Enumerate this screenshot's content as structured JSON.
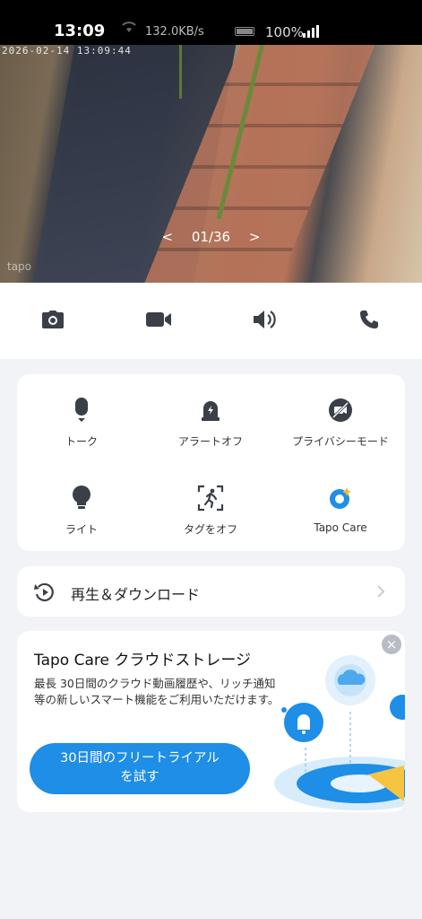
{
  "status_bar": {
    "time": "13:09",
    "network_speed": "132.0KB/s",
    "battery": "100%"
  },
  "camera": {
    "timestamp": "2026-02-14 13:09:44",
    "pager": {
      "prev": "<",
      "position": "01/36",
      "next": ">"
    },
    "watermark": "tapo"
  },
  "controls": {
    "items": [
      {
        "name": "snapshot",
        "icon": "camera-icon"
      },
      {
        "name": "record",
        "icon": "video-camera-icon"
      },
      {
        "name": "speaker",
        "icon": "speaker-icon"
      },
      {
        "name": "call",
        "icon": "phone-icon"
      }
    ]
  },
  "features": {
    "items": [
      {
        "label": "トーク",
        "icon": "microphone-icon"
      },
      {
        "label": "アラートオフ",
        "icon": "alarm-bell-icon"
      },
      {
        "label": "プライバシーモード",
        "icon": "privacy-camera-off-icon"
      },
      {
        "label": "ライト",
        "icon": "lightbulb-icon"
      },
      {
        "label": "タグをオフ",
        "icon": "person-tracking-icon"
      },
      {
        "label": "Tapo Care",
        "icon": "tapo-care-icon"
      }
    ]
  },
  "playback": {
    "label": "再生＆ダウンロード",
    "icon": "playback-icon"
  },
  "promo": {
    "title": "Tapo Care クラウドストレージ",
    "description": "最長 30日間のクラウド動画履歴や、リッチ通知等の新しいスマート機能をご利用いただけます。",
    "button_line1": "30日間のフリートライアル",
    "button_line2": "を試す"
  },
  "colors": {
    "accent": "#1e8ee6",
    "background": "#f2f3f7",
    "icon": "#3a3f48"
  }
}
